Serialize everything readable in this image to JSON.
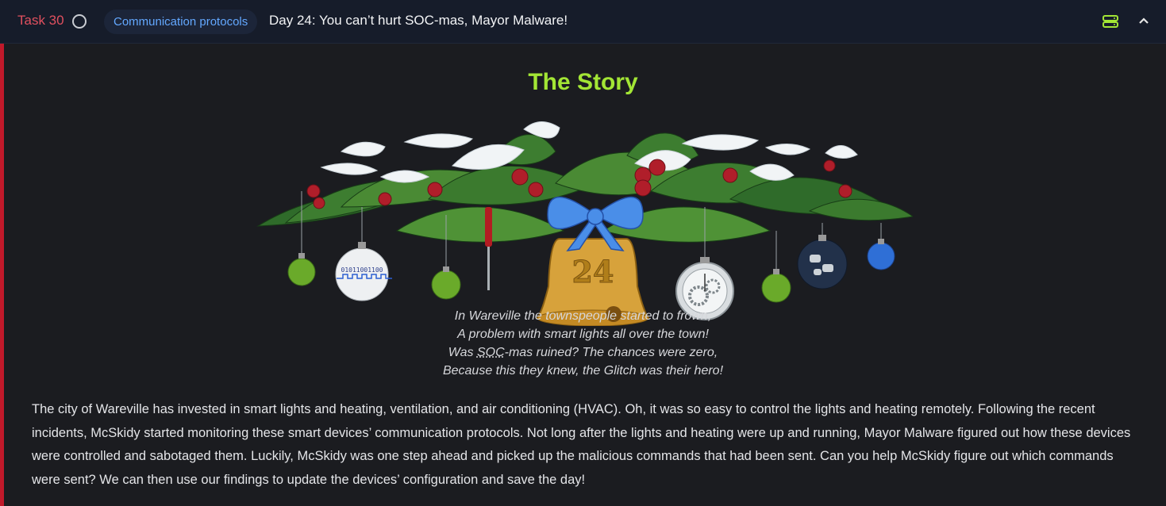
{
  "header": {
    "task_label": "Task 30",
    "category_pill": "Communication protocols",
    "title": "Day 24: You can’t hurt SOC-mas, Mayor Malware!"
  },
  "icons": {
    "status": "circle-outline-icon",
    "server": "server-icon",
    "collapse": "chevron-up-icon"
  },
  "colors": {
    "accent_red": "#c1192a",
    "story_green": "#a3e635",
    "pill_blue": "#63a8ff"
  },
  "story": {
    "heading": "The Story",
    "image_alt": "Christmas garland with ornaments and a bell",
    "bell_number": "24",
    "ornament_binary": "01011001100",
    "poem": {
      "line1": "In Wareville the townspeople started to frown,",
      "line2": "A problem with smart lights all over the town!",
      "line3_abbr": "SOC",
      "line3_pre": "Was ",
      "line3_post": "-mas ruined? The chances were zero,",
      "line4": "Because this they knew, the Glitch was their hero!"
    },
    "paragraph": "The city of Wareville has invested in smart lights and heating, ventilation, and air conditioning (HVAC). Oh, it was so easy to control the lights and heating remotely. Following the recent incidents, McSkidy started monitoring these smart devices’ communication protocols. Not long after the lights and heating were up and running, Mayor Malware figured out how these devices were controlled and sabotaged them. Luckily, McSkidy was one step ahead and picked up the malicious commands that had been sent. Can you help McSkidy figure out which commands were sent? We can then use our findings to update the devices’ configuration and save the day!"
  }
}
